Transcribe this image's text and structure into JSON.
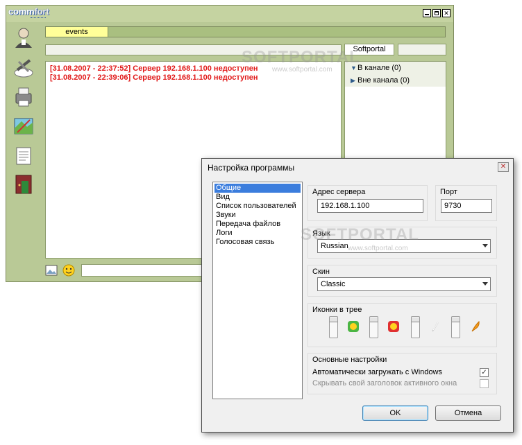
{
  "main_window": {
    "logo_prefix": "comm",
    "logo_suffix": "fort",
    "active_tab": "events",
    "log": [
      "[31.08.2007 - 22:37:52] Сервер 192.168.1.100 недоступен",
      "[31.08.2007 - 22:39:06] Сервер 192.168.1.100 недоступен"
    ],
    "user_tab": "Softportal",
    "user_groups": [
      {
        "label": "В канале (0)",
        "expanded": true
      },
      {
        "label": "Вне канала (0)",
        "expanded": false
      }
    ],
    "sidebar_icons": [
      "user-icon",
      "tools-icon",
      "printer-icon",
      "map-icon",
      "notes-icon",
      "exit-door-icon"
    ],
    "message_input": "",
    "colors": {
      "frame": "#b9c996",
      "tab_active": "#ffff99",
      "log_text": "#e11818"
    }
  },
  "dialog": {
    "title": "Настройка программы",
    "close_glyph": "✕",
    "categories": [
      "Общие",
      "Вид",
      "Список пользователей",
      "Звуки",
      "Передача файлов",
      "Логи",
      "Голосовая связь"
    ],
    "selected_category": "Общие",
    "server": {
      "label": "Адрес сервера",
      "value": "192.168.1.100"
    },
    "port": {
      "label": "Порт",
      "value": "9730"
    },
    "language": {
      "label": "Язык",
      "value": "Russian"
    },
    "skin": {
      "label": "Скин",
      "value": "Classic"
    },
    "tray": {
      "label": "Иконки в трее",
      "icons": [
        "green-smile-icon",
        "red-smile-icon",
        "feather-white-icon",
        "feather-orange-icon"
      ]
    },
    "basic": {
      "label": "Основные настройки",
      "autostart": {
        "label": "Автоматически загружать с Windows",
        "checked": true
      },
      "hide_title": {
        "label": "Скрывать свой заголовок активного окна",
        "checked": false,
        "disabled": true
      }
    },
    "ok_label": "OK",
    "cancel_label": "Отмена"
  },
  "watermark": {
    "text": "SOFTPORTAL",
    "sub": "www.softportal.com"
  }
}
